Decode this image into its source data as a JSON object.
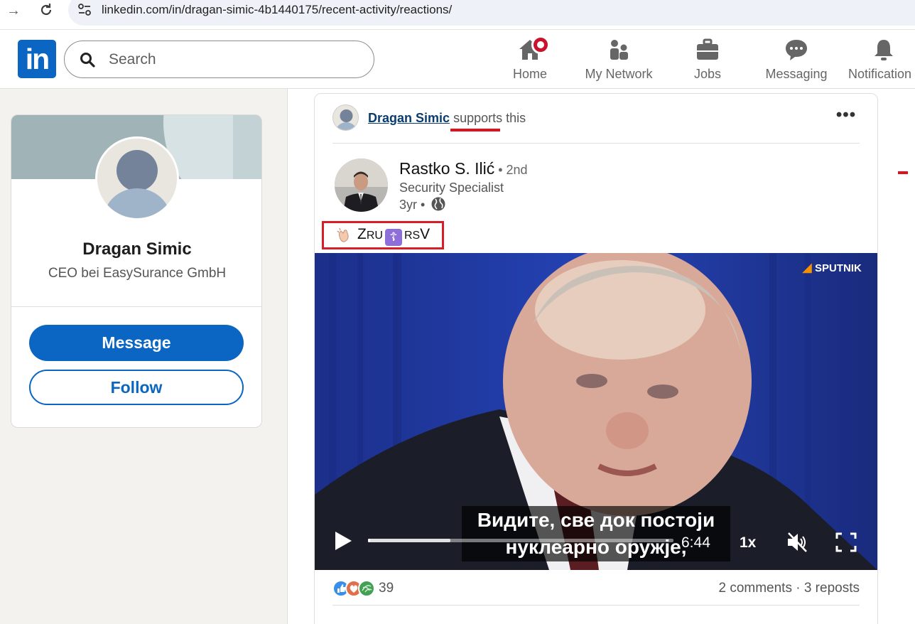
{
  "browser": {
    "url": "linkedin.com/in/dragan-simic-4b1440175/recent-activity/reactions/"
  },
  "header": {
    "logo_text": "in",
    "search_placeholder": "Search",
    "nav": [
      {
        "label": "Home",
        "icon": "home-icon"
      },
      {
        "label": "My Network",
        "icon": "network-icon"
      },
      {
        "label": "Jobs",
        "icon": "briefcase-icon"
      },
      {
        "label": "Messaging",
        "icon": "messaging-icon"
      },
      {
        "label": "Notification",
        "icon": "bell-icon"
      }
    ]
  },
  "profile": {
    "name": "Dragan Simic",
    "headline": "CEO bei EasySurance GmbH",
    "message_label": "Message",
    "follow_label": "Follow"
  },
  "post": {
    "actor_name": "Dragan Simic",
    "actor_verb": "supports",
    "actor_suffix": " this",
    "author_name": "Rastko S. Ilić",
    "author_degree": " • 2nd",
    "author_title": "Security Specialist",
    "author_time": "3yr •",
    "text_z": "Z",
    "text_ru": "RU",
    "text_cross": "☦",
    "text_rs": "RS",
    "text_v": "V",
    "video": {
      "brand": "SPUTNIK",
      "subtitle_line1": "Видите, све док постоји",
      "subtitle_line2": "нуклеарно оружје,",
      "time": "6:44",
      "speed": "1x",
      "progress_fraction": 0.0,
      "buffered_fraction": 0.27
    },
    "reaction_count": "39",
    "comments_reposts": "2 comments · 3 reposts"
  },
  "colors": {
    "linkedin_blue": "#0a66c2",
    "highlight_red": "#d81e28",
    "notification_red": "#cb112d"
  }
}
